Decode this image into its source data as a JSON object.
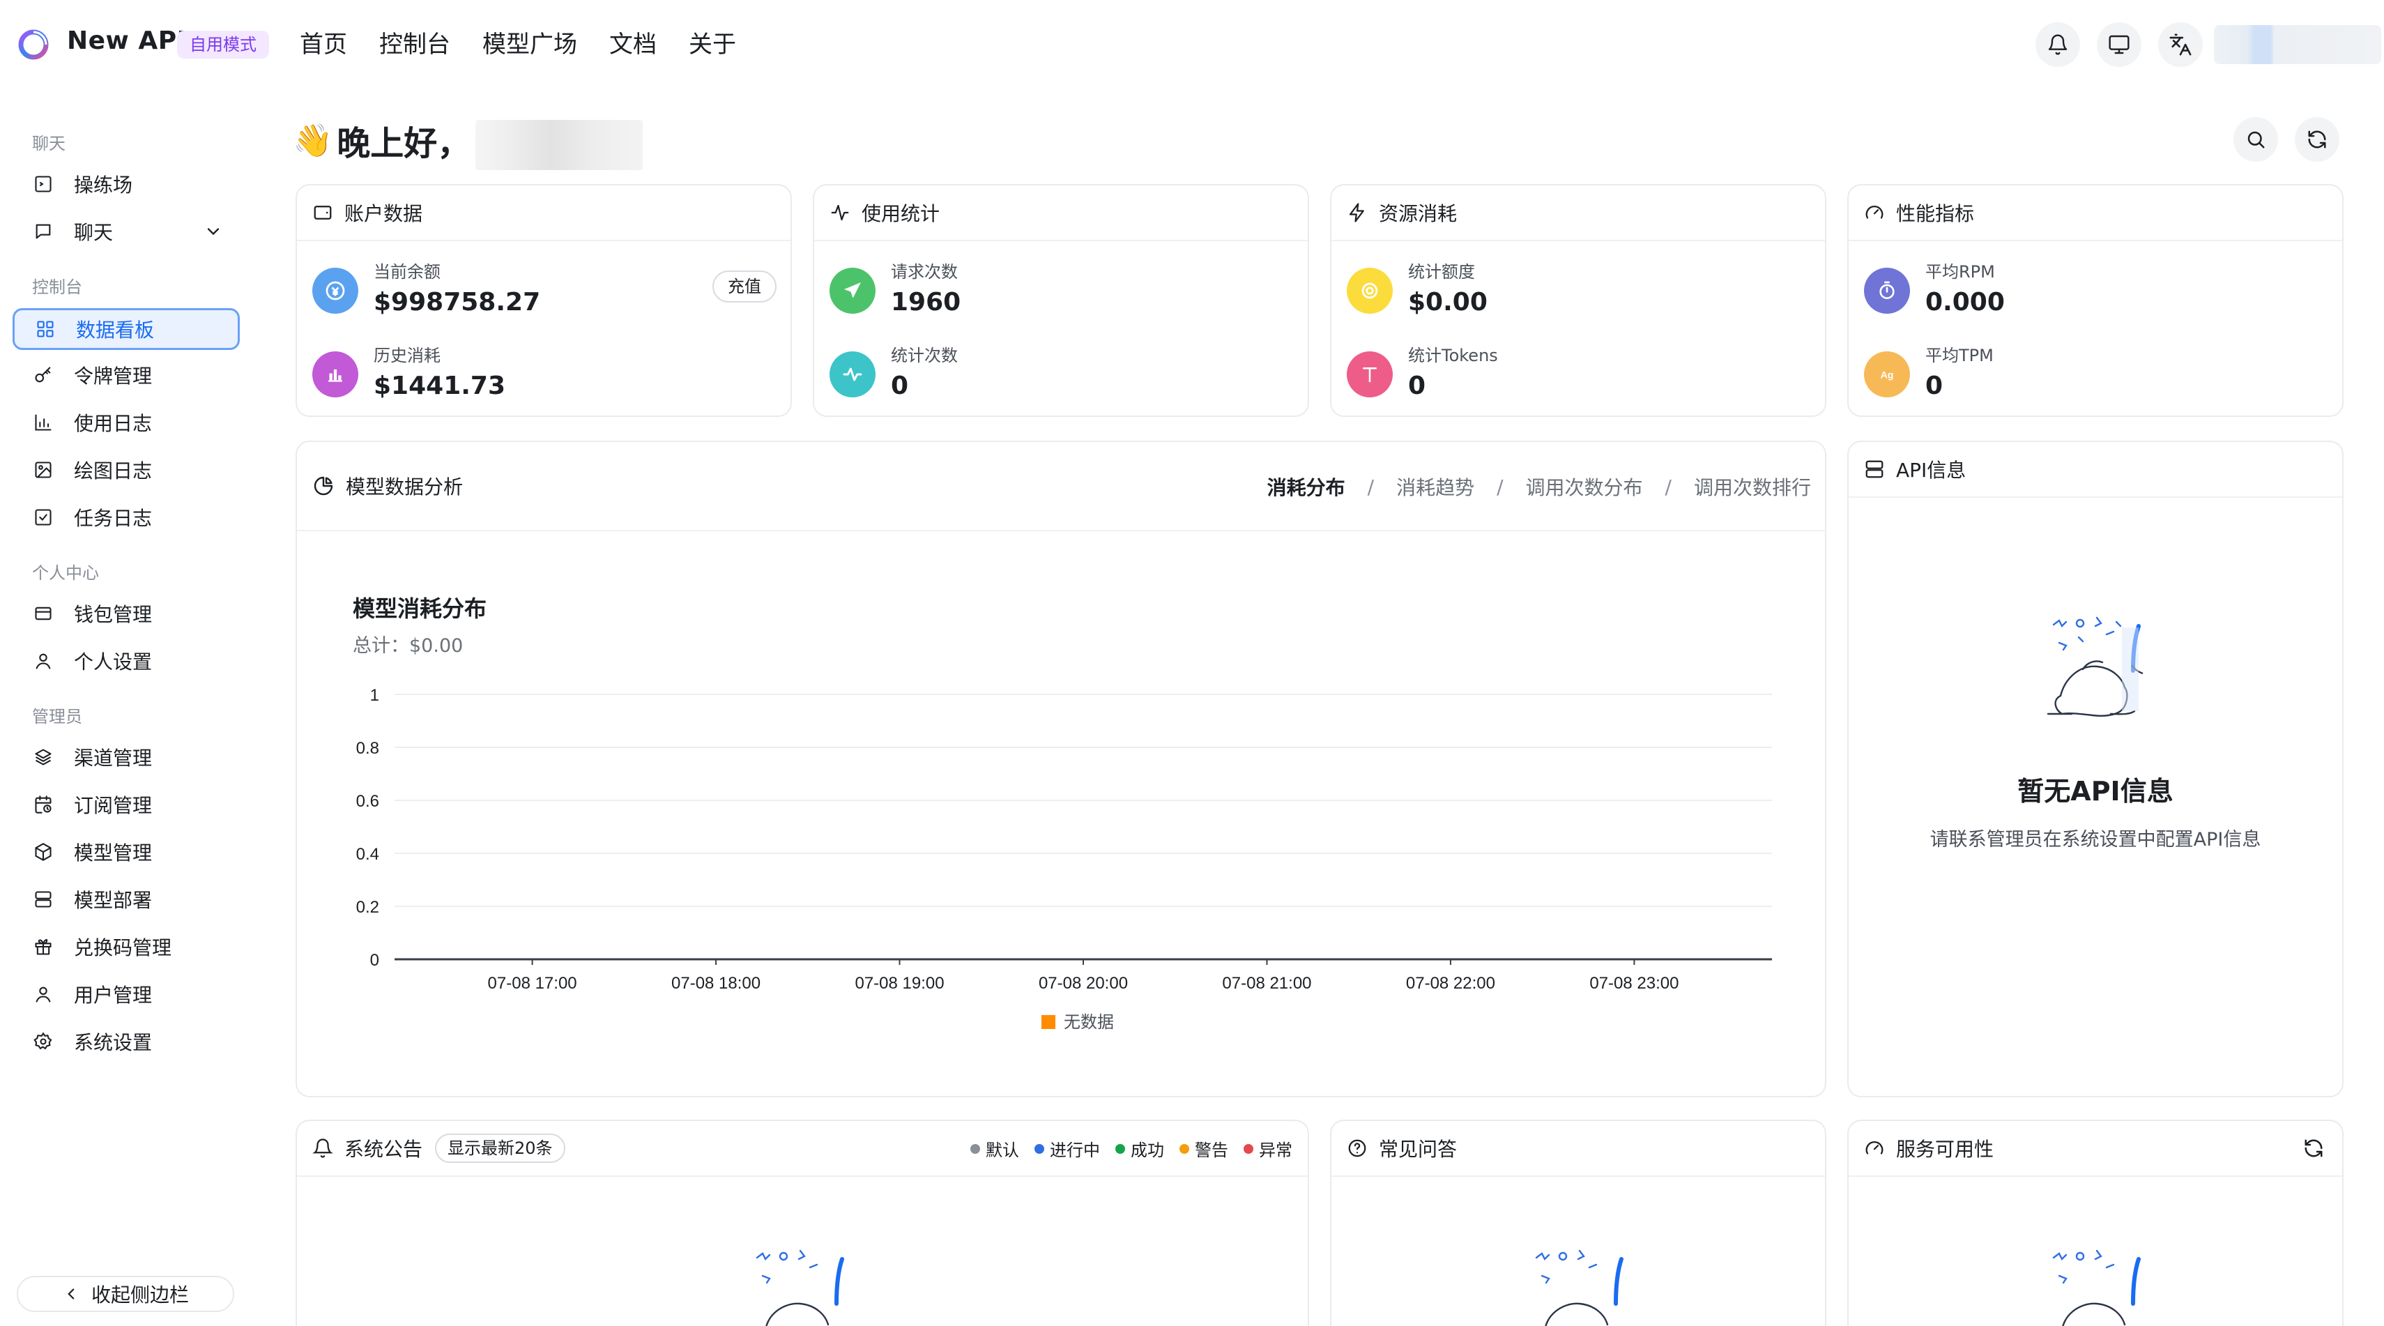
{
  "app": {
    "brand": "New API",
    "mode_badge": "自用模式"
  },
  "topnav": [
    "首页",
    "控制台",
    "模型广场",
    "文档",
    "关于"
  ],
  "header_icons": [
    "bell-icon",
    "monitor-icon",
    "translate-icon"
  ],
  "sidebar": {
    "sections": [
      {
        "title": "聊天",
        "items": [
          {
            "label": "操练场",
            "icon": "playground-icon"
          },
          {
            "label": "聊天",
            "icon": "chat-icon",
            "expandable": true
          }
        ]
      },
      {
        "title": "控制台",
        "items": [
          {
            "label": "数据看板",
            "icon": "dashboard-icon",
            "active": true
          },
          {
            "label": "令牌管理",
            "icon": "key-icon"
          },
          {
            "label": "使用日志",
            "icon": "bar-chart-icon"
          },
          {
            "label": "绘图日志",
            "icon": "image-icon"
          },
          {
            "label": "任务日志",
            "icon": "task-check-icon"
          }
        ]
      },
      {
        "title": "个人中心",
        "items": [
          {
            "label": "钱包管理",
            "icon": "wallet-icon"
          },
          {
            "label": "个人设置",
            "icon": "user-icon"
          }
        ]
      },
      {
        "title": "管理员",
        "items": [
          {
            "label": "渠道管理",
            "icon": "layers-icon"
          },
          {
            "label": "订阅管理",
            "icon": "calendar-clock-icon"
          },
          {
            "label": "模型管理",
            "icon": "cube-icon"
          },
          {
            "label": "模型部署",
            "icon": "server-icon"
          },
          {
            "label": "兑换码管理",
            "icon": "gift-icon"
          },
          {
            "label": "用户管理",
            "icon": "user-icon"
          },
          {
            "label": "系统设置",
            "icon": "gear-icon"
          }
        ]
      }
    ],
    "collapse_label": "收起侧边栏"
  },
  "greeting": "晚上好，",
  "cards": {
    "account": {
      "title": "账户数据",
      "balance_label": "当前余额",
      "balance_value": "$998758.27",
      "recharge_label": "充值",
      "spent_label": "历史消耗",
      "spent_value": "$1441.73"
    },
    "usage": {
      "title": "使用统计",
      "requests_label": "请求次数",
      "requests_value": "1960",
      "count_label": "统计次数",
      "count_value": "0"
    },
    "resource": {
      "title": "资源消耗",
      "quota_label": "统计额度",
      "quota_value": "$0.00",
      "tokens_label": "统计Tokens",
      "tokens_value": "0"
    },
    "performance": {
      "title": "性能指标",
      "rpm_label": "平均RPM",
      "rpm_value": "0.000",
      "tpm_label": "平均TPM",
      "tpm_value": "0"
    }
  },
  "analysis": {
    "title": "模型数据分析",
    "tabs": [
      "消耗分布",
      "消耗趋势",
      "调用次数分布",
      "调用次数排行"
    ],
    "chart_title": "模型消耗分布",
    "chart_total": "总计：$0.00"
  },
  "chart_data": {
    "type": "bar",
    "title": "模型消耗分布",
    "categories": [
      "07-08 17:00",
      "07-08 18:00",
      "07-08 19:00",
      "07-08 20:00",
      "07-08 21:00",
      "07-08 22:00",
      "07-08 23:00"
    ],
    "series": [
      {
        "name": "无数据",
        "values": [
          0,
          0,
          0,
          0,
          0,
          0,
          0
        ],
        "color": "#ff8c00"
      }
    ],
    "yticks": [
      "1",
      "0.8",
      "0.6",
      "0.4",
      "0.2",
      "0"
    ],
    "ylim": [
      0,
      1
    ],
    "grid": true,
    "legend": "bottom"
  },
  "api_info": {
    "title": "API信息",
    "empty_title": "暂无API信息",
    "empty_desc": "请联系管理员在系统设置中配置API信息"
  },
  "announcements": {
    "title": "系统公告",
    "pill": "显示最新20条",
    "legend": [
      {
        "label": "默认",
        "color": "#8a8f98"
      },
      {
        "label": "进行中",
        "color": "#2f6fe4"
      },
      {
        "label": "成功",
        "color": "#16a34a"
      },
      {
        "label": "警告",
        "color": "#f59e0b"
      },
      {
        "label": "异常",
        "color": "#e5484d"
      }
    ]
  },
  "faq": {
    "title": "常见问答"
  },
  "availability": {
    "title": "服务可用性"
  }
}
